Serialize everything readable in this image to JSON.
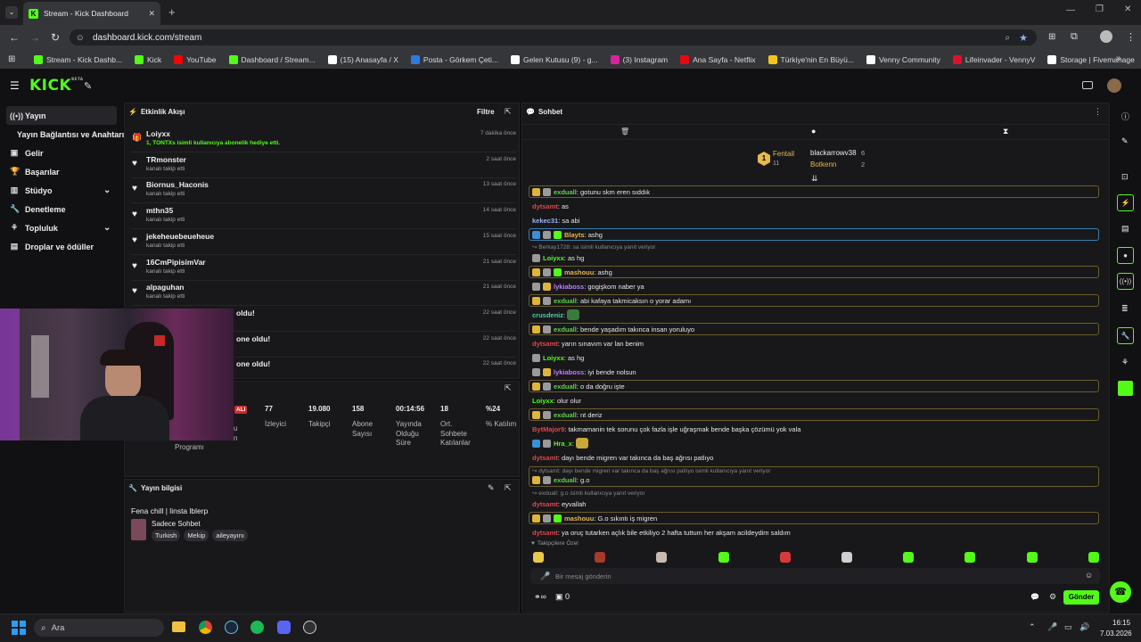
{
  "browser": {
    "tab_title": "Stream - Kick Dashboard",
    "url": "dashboard.kick.com/stream",
    "bookmarks": [
      {
        "label": "Stream - Kick Dashb...",
        "icon": "kick-icon",
        "color": "#53fc18"
      },
      {
        "label": "Kick",
        "icon": "kick-icon",
        "color": "#53fc18"
      },
      {
        "label": "YouTube",
        "icon": "youtube-icon",
        "color": "#ff0000"
      },
      {
        "label": "Dashboard / Stream...",
        "icon": "kick-icon",
        "color": "#53fc18"
      },
      {
        "label": "(15) Anasayfa / X",
        "icon": "x-icon",
        "color": "#ffffff"
      },
      {
        "label": "Posta - Görkem Çeti...",
        "icon": "outlook-icon",
        "color": "#2d7be0"
      },
      {
        "label": "Gelen Kutusu (9) - g...",
        "icon": "google-icon",
        "color": "#ffffff"
      },
      {
        "label": "(3) Instagram",
        "icon": "instagram-icon",
        "color": "#d6249f"
      },
      {
        "label": "Ana Sayfa - Netflix",
        "icon": "netflix-icon",
        "color": "#e50914"
      },
      {
        "label": "Türkiye'nin En Büyü...",
        "icon": "site-icon",
        "color": "#f5c518"
      },
      {
        "label": "Venny Community",
        "icon": "venny-icon",
        "color": "#ffffff"
      },
      {
        "label": "Lifeinvader - VennyV",
        "icon": "lifeinvader-icon",
        "color": "#e0102a"
      },
      {
        "label": "Storage | Fivemanage",
        "icon": "fivemanage-icon",
        "color": "#ffffff"
      }
    ]
  },
  "kick": {
    "logo": "KICK",
    "beta": "BETA"
  },
  "sidebar": {
    "items": [
      {
        "label": "Yayın",
        "icon": "broadcast-icon",
        "active": true
      },
      {
        "label": "Yayın Bağlantısı ve Anahtarı",
        "icon": "",
        "active": false
      },
      {
        "label": "Gelir",
        "icon": "money-icon",
        "active": false
      },
      {
        "label": "Başarılar",
        "icon": "trophy-icon",
        "active": false
      },
      {
        "label": "Stüdyo",
        "icon": "studio-icon",
        "active": false,
        "chevron": true
      },
      {
        "label": "Denetleme",
        "icon": "wrench-icon",
        "active": false
      },
      {
        "label": "Topluluk",
        "icon": "community-icon",
        "active": false,
        "chevron": true
      },
      {
        "label": "Droplar ve ödüller",
        "icon": "drops-icon",
        "active": false
      }
    ]
  },
  "activity": {
    "title": "Etkinlik Akışı",
    "filter": "Filtre",
    "items": [
      {
        "name": "Loiyxx",
        "sub": "1, TONTXs isimli kullanıcıya abonelik hediye etti.",
        "time": "7 dakika önce",
        "type": "gift"
      },
      {
        "name": "TRmonster",
        "sub": "kanalı takip etti",
        "time": "2 saat önce",
        "type": "follow"
      },
      {
        "name": "Biornus_Haconis",
        "sub": "kanalı takip etti",
        "time": "13 saat önce",
        "type": "follow"
      },
      {
        "name": "mthn35",
        "sub": "kanalı takip etti",
        "time": "14 saat önce",
        "type": "follow"
      },
      {
        "name": "jekeheuebeueheue",
        "sub": "kanalı takip etti",
        "time": "15 saat önce",
        "type": "follow"
      },
      {
        "name": "16CmPipisimVar",
        "sub": "kanalı takip etti",
        "time": "21 saat önce",
        "type": "follow"
      },
      {
        "name": "alpaguhan",
        "sub": "kanalı takip etti",
        "time": "21 saat önce",
        "type": "follow"
      },
      {
        "name": "oldu!",
        "sub": "",
        "time": "22 saat önce",
        "type": "hidden"
      },
      {
        "name": "one oldu!",
        "sub": "",
        "time": "22 saat önce",
        "type": "hidden"
      },
      {
        "name": "one oldu!",
        "sub": "",
        "time": "22 saat önce",
        "type": "hidden"
      }
    ]
  },
  "stats": {
    "live_badge": "ALI",
    "partial_label_1": "u",
    "partial_label_2": "n",
    "program_label": "Programı",
    "items": [
      {
        "value": "77",
        "label": "İzleyici"
      },
      {
        "value": "19.080",
        "label": "Takipçi"
      },
      {
        "value": "158",
        "label": "Abone Sayısı"
      },
      {
        "value": "00:14:56",
        "label": "Yayında Olduğu Süre"
      },
      {
        "value": "18",
        "label": "Ort. Sohbete Katılanlar"
      },
      {
        "value": "%24",
        "label": "% Katılım"
      }
    ]
  },
  "stream_info": {
    "title": "Yayın bilgisi",
    "stream_title": "Fena chill | linsta lblerp",
    "category": "Sadece Sohbet",
    "tags": [
      "Turkish",
      "Mekip",
      "aileyayını"
    ]
  },
  "chat": {
    "title": "Sohbet",
    "leaderboard": {
      "rank": "1",
      "gifter1": "Fentail",
      "gifter1_count": "11",
      "user2": "blackarrowv38",
      "user2_count": "6",
      "user3": "Botkenn",
      "user3_count": "2"
    },
    "messages": [
      {
        "user": "exduall",
        "text": "gotunu skm eren sıddık",
        "color": "#5fcf4f",
        "hl": "gold",
        "badges": [
          "#e0b43a",
          "#9a9a9a"
        ]
      },
      {
        "user": "dytsamt",
        "text": "as",
        "color": "#e0454a",
        "hl": "",
        "badges": []
      },
      {
        "user": "kekec31",
        "text": "sa abi",
        "color": "#9ab3ff",
        "hl": "",
        "badges": []
      },
      {
        "user": "Blayts",
        "text": "ashg",
        "color": "#e8b84a",
        "hl": "blue",
        "badges": [
          "#3a8fd6",
          "#9a9a9a",
          "#53fc18"
        ]
      },
      {
        "reply": "Berkay1728: sa isimli kullanıcıya yanıt veriyor"
      },
      {
        "user": "Loiyxx",
        "text": "as hg",
        "color": "#53fc18",
        "hl": "",
        "badges": [
          "#9a9a9a"
        ]
      },
      {
        "user": "mashouu",
        "text": "ashg",
        "color": "#e8b84a",
        "hl": "gold",
        "badges": [
          "#e0b43a",
          "#9a9a9a",
          "#53fc18"
        ]
      },
      {
        "user": "lykiaboss",
        "text": "gogişkom naber ya",
        "color": "#c47cff",
        "hl": "",
        "badges": [
          "#9a9a9a",
          "#e0b43a"
        ]
      },
      {
        "user": "exduall",
        "text": "abi kafaya takmicaksın o yorar adamı",
        "color": "#5fcf4f",
        "hl": "gold",
        "badges": [
          "#e0b43a",
          "#9a9a9a"
        ]
      },
      {
        "user": "crusdeniz",
        "text": "",
        "color": "#4fcf9f",
        "hl": "",
        "badges": [],
        "emote": "#3a7a3a"
      },
      {
        "user": "exduall",
        "text": "bende yaşadım takınca insan yoruluyo",
        "color": "#5fcf4f",
        "hl": "gold",
        "badges": [
          "#e0b43a",
          "#9a9a9a"
        ]
      },
      {
        "user": "dytsamt",
        "text": "yarın sınavım var lan benim",
        "color": "#e0454a",
        "hl": "",
        "badges": []
      },
      {
        "user": "Loiyxx",
        "text": "as hg",
        "color": "#53fc18",
        "hl": "",
        "badges": [
          "#9a9a9a"
        ]
      },
      {
        "user": "lykiaboss",
        "text": "iyi bende nolsun",
        "color": "#c47cff",
        "hl": "",
        "badges": [
          "#9a9a9a",
          "#e0b43a"
        ]
      },
      {
        "user": "exduall",
        "text": "o da doğru işte",
        "color": "#5fcf4f",
        "hl": "gold",
        "badges": [
          "#e0b43a",
          "#9a9a9a"
        ]
      },
      {
        "user": "Loiyxx",
        "text": "olur olur",
        "color": "#53fc18",
        "hl": "",
        "badges": []
      },
      {
        "user": "exduall",
        "text": "nt deriz",
        "color": "#5fcf4f",
        "hl": "gold",
        "badges": [
          "#e0b43a",
          "#9a9a9a"
        ]
      },
      {
        "user": "BytMajor9",
        "text": "takmamanin tek sorunu çok fazla işle uğraşmak bende başka çözümü yok vala",
        "color": "#e0454a",
        "hl": "",
        "badges": []
      },
      {
        "user": "Hra_x",
        "text": "",
        "color": "#53fc18",
        "hl": "",
        "badges": [
          "#3a8fd6",
          "#9a9a9a"
        ],
        "emote": "#c8a83a"
      },
      {
        "user": "dytsamt",
        "text": "dayı bende migren var takınca da baş ağrısı patlıyo",
        "color": "#e0454a",
        "hl": "",
        "badges": []
      },
      {
        "reply": "dytsamt: dayı bende migren var takınca da baş ağrısı patlıyo isimli kullanıcıya yanıt veriyor",
        "boxed": true
      },
      {
        "user": "exduall",
        "text": "g.o",
        "color": "#5fcf4f",
        "hl": "gold-cont",
        "badges": [
          "#e0b43a",
          "#9a9a9a"
        ]
      },
      {
        "reply": "exduall: g.o isimli kullanıcıya yanıt veriyor"
      },
      {
        "user": "dytsamt",
        "text": "eyvallah",
        "color": "#e0454a",
        "hl": "",
        "badges": []
      },
      {
        "user": "mashouu",
        "text": "G.o sıkıntı iş migren",
        "color": "#e8b84a",
        "hl": "gold",
        "badges": [
          "#e0b43a",
          "#9a9a9a",
          "#53fc18"
        ]
      },
      {
        "user": "dytsamt",
        "text": "ya oruç tutarken açlık bile etkiliyo 2 hafta tuttum her akşam acildeydim saldım",
        "color": "#e0454a",
        "hl": "",
        "badges": []
      }
    ],
    "emotes_label": "Takipçilere Özel",
    "input_placeholder": "Bir mesaj gönderin",
    "send": "Gönder",
    "footer_count": "0"
  },
  "taskbar": {
    "search": "Ara",
    "time": "16:15",
    "date": "7.03.2026"
  }
}
